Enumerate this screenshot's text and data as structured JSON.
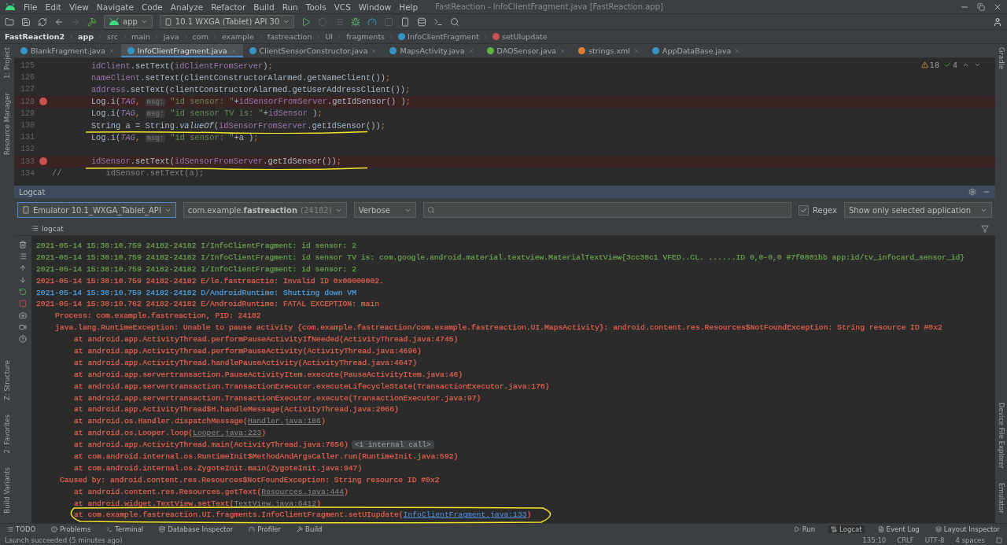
{
  "window": {
    "title": "FastReaction - InfoClientFragment.java [FastReaction.app]"
  },
  "menu": [
    "File",
    "Edit",
    "View",
    "Navigate",
    "Code",
    "Analyze",
    "Refactor",
    "Build",
    "Run",
    "Tools",
    "VCS",
    "Window",
    "Help"
  ],
  "toolbar": {
    "run_config": "app",
    "device": "10.1  WXGA (Tablet) API 30"
  },
  "breadcrumb": [
    {
      "label": "FastReaction2",
      "kind": "project"
    },
    {
      "label": "app",
      "kind": "module"
    },
    {
      "label": "src",
      "kind": "folder"
    },
    {
      "label": "main",
      "kind": "folder"
    },
    {
      "label": "java",
      "kind": "folder"
    },
    {
      "label": "com",
      "kind": "folder"
    },
    {
      "label": "example",
      "kind": "folder"
    },
    {
      "label": "fastreaction",
      "kind": "folder"
    },
    {
      "label": "UI",
      "kind": "folder"
    },
    {
      "label": "fragments",
      "kind": "folder"
    },
    {
      "label": "InfoClientFragment",
      "kind": "class"
    },
    {
      "label": "setUIupdate",
      "kind": "method"
    }
  ],
  "tabs": [
    {
      "label": "BlankFragment.java",
      "kind": "class",
      "selected": false
    },
    {
      "label": "InfoClientFragment.java",
      "kind": "class",
      "selected": true
    },
    {
      "label": "ClientSensorConstructor.java",
      "kind": "class",
      "selected": false
    },
    {
      "label": "MapsActivity.java",
      "kind": "class",
      "selected": false
    },
    {
      "label": "DAOSensor.java",
      "kind": "interface",
      "selected": false
    },
    {
      "label": "strings.xml",
      "kind": "xml",
      "selected": false
    },
    {
      "label": "AppDataBase.java",
      "kind": "class",
      "selected": false
    }
  ],
  "left_strip": {
    "top": [
      "1: Project",
      "Resource Manager"
    ],
    "bottom": [
      "Z: Structure",
      "2: Favorites",
      "Build Variants"
    ]
  },
  "right_strip": {
    "top": [
      "Gradle"
    ],
    "bottom": [
      "Device File Explorer",
      "Emulator"
    ]
  },
  "editor": {
    "warnings": "18",
    "checks": "4",
    "lines": [
      {
        "number": "125",
        "breakpoint": false,
        "underlined": false,
        "tokens": [
          {
            "kind": "field",
            "t": "        idClient"
          },
          {
            "kind": "plain",
            "t": ".setText("
          },
          {
            "kind": "field",
            "t": "idClientFromServer"
          },
          {
            "kind": "plain",
            "t": ")"
          },
          {
            "kind": "punct",
            "t": ";"
          }
        ]
      },
      {
        "number": "126",
        "breakpoint": false,
        "underlined": false,
        "tokens": [
          {
            "kind": "field",
            "t": "        nameClient"
          },
          {
            "kind": "plain",
            "t": ".setText(clientConstructorAlarmed.getNameClient())"
          },
          {
            "kind": "punct",
            "t": ";"
          }
        ]
      },
      {
        "number": "127",
        "breakpoint": false,
        "underlined": false,
        "tokens": [
          {
            "kind": "field",
            "t": "        address"
          },
          {
            "kind": "plain",
            "t": ".setText(clientConstructorAlarmed.getUserAddressClient())"
          },
          {
            "kind": "punct",
            "t": ";"
          }
        ]
      },
      {
        "number": "128",
        "breakpoint": true,
        "underlined": false,
        "tokens": [
          {
            "kind": "plain",
            "t": "        Log.i("
          },
          {
            "kind": "static",
            "t": "TAG"
          },
          {
            "kind": "punct",
            "t": ", "
          },
          {
            "kind": "hint",
            "t": "msg:"
          },
          {
            "kind": "string",
            "t": " \"id sensor: \""
          },
          {
            "kind": "plain",
            "t": "+"
          },
          {
            "kind": "field",
            "t": "idSensorFromServer"
          },
          {
            "kind": "plain",
            "t": ".getIdSensor() )"
          },
          {
            "kind": "punct",
            "t": ";"
          }
        ]
      },
      {
        "number": "129",
        "breakpoint": false,
        "underlined": false,
        "tokens": [
          {
            "kind": "plain",
            "t": "        Log.i("
          },
          {
            "kind": "static",
            "t": "TAG"
          },
          {
            "kind": "punct",
            "t": ", "
          },
          {
            "kind": "hint",
            "t": "msg:"
          },
          {
            "kind": "string",
            "t": " \"id sensor TV is: \""
          },
          {
            "kind": "plain",
            "t": "+"
          },
          {
            "kind": "field",
            "t": "idSensor"
          },
          {
            "kind": "plain",
            "t": " )"
          },
          {
            "kind": "punct",
            "t": ";"
          }
        ]
      },
      {
        "number": "130",
        "breakpoint": false,
        "underlined": true,
        "tokens": [
          {
            "kind": "plain",
            "t": "        String a = String."
          },
          {
            "kind": "italic",
            "t": "valueOf"
          },
          {
            "kind": "plain",
            "t": "("
          },
          {
            "kind": "field",
            "t": "idSensorFromServer"
          },
          {
            "kind": "plain",
            "t": ".getIdSensor())"
          },
          {
            "kind": "punct",
            "t": ";"
          }
        ]
      },
      {
        "number": "131",
        "breakpoint": false,
        "underlined": false,
        "tokens": [
          {
            "kind": "plain",
            "t": "        Log.i("
          },
          {
            "kind": "static",
            "t": "TAG"
          },
          {
            "kind": "punct",
            "t": ", "
          },
          {
            "kind": "hint",
            "t": "msg:"
          },
          {
            "kind": "string",
            "t": " \"id sensor: \""
          },
          {
            "kind": "plain",
            "t": "+a )"
          },
          {
            "kind": "punct",
            "t": ";"
          }
        ]
      },
      {
        "number": "132",
        "breakpoint": false,
        "underlined": false
      },
      {
        "number": "133",
        "breakpoint": true,
        "underlined": true,
        "tokens": [
          {
            "kind": "field",
            "t": "        idSensor"
          },
          {
            "kind": "plain",
            "t": ".setText("
          },
          {
            "kind": "field",
            "t": "idSensorFromServer"
          },
          {
            "kind": "plain",
            "t": ".getIdSensor())"
          },
          {
            "kind": "punct",
            "t": ";"
          }
        ]
      },
      {
        "number": "134",
        "breakpoint": false,
        "underlined": false,
        "tokens": [
          {
            "kind": "comment",
            "t": "//         idSensor.setText(a);"
          }
        ]
      }
    ]
  },
  "logcat": {
    "title": "Logcat",
    "device": "Emulator 10.1_WXGA_Tablet_API",
    "package": "com.example.**fastreaction**",
    "pid": "(24182)",
    "level": "Verbose",
    "regex": {
      "label": "Regex",
      "checked": true
    },
    "scope": "Show only selected application",
    "subtab": "logcat",
    "lines": [
      {
        "color": "#6a9f4f",
        "kind": "entry",
        "text": "2021-05-14 15:38:10.759 24182-24182 I/InfoClientFragment: id sensor: 2"
      },
      {
        "color": "#6a9f4f",
        "kind": "entry",
        "text": "2021-05-14 15:38:10.759 24182-24182 I/InfoClientFragment: id sensor TV is: com.google.android.material.textview.MaterialTextView{3cc38c1 VFED..CL. ......ID 0,0-0,0 #7f0801bb app:id/tv_infocard_sensor_id}"
      },
      {
        "color": "#6a9f4f",
        "kind": "entry",
        "text": "2021-05-14 15:38:10.759 24182-24182 I/InfoClientFragment: id sensor: 2"
      },
      {
        "color": "#e0604f",
        "kind": "entry",
        "text": "2021-05-14 15:38:10.759 24182-24182 E/le.fastreactio: Invalid ID 0x00000002."
      },
      {
        "color": "#4a9fe0",
        "kind": "entry",
        "text": "2021-05-14 15:38:10.759 24182-24182 D/AndroidRuntime: Shutting down VM"
      },
      {
        "color": "#e0604f",
        "kind": "entry",
        "text": "2021-05-14 15:38:10.762 24182-24182 E/AndroidRuntime: FATAL EXCEPTION: main"
      },
      {
        "color": "#e0604f",
        "kind": "detail",
        "text": "Process: com.example.fastreaction, PID: 24182"
      },
      {
        "color": "#e0604f",
        "kind": "detail",
        "text": "java.lang.RuntimeException: Unable to pause activity {com.example.fastreaction/com.example.fastreaction.UI.MapsActivity}: android.content.res.Resources$NotFoundException: String resource ID #0x2"
      },
      {
        "color": "#e0604f",
        "kind": "frame",
        "text": "at android.app.ActivityThread.performPauseActivityIfNeeded(ActivityThread.java:4745)"
      },
      {
        "color": "#e0604f",
        "kind": "frame",
        "text": "at android.app.ActivityThread.performPauseActivity(ActivityThread.java:4696)"
      },
      {
        "color": "#e0604f",
        "kind": "frame",
        "text": "at android.app.ActivityThread.handlePauseActivity(ActivityThread.java:4647)"
      },
      {
        "color": "#e0604f",
        "kind": "frame",
        "text": "at android.app.servertransaction.PauseActivityItem.execute(PauseActivityItem.java:46)"
      },
      {
        "color": "#e0604f",
        "kind": "frame",
        "text": "at android.app.servertransaction.TransactionExecutor.executeLifecycleState(TransactionExecutor.java:176)"
      },
      {
        "color": "#e0604f",
        "kind": "frame",
        "text": "at android.app.servertransaction.TransactionExecutor.execute(TransactionExecutor.java:97)"
      },
      {
        "color": "#e0604f",
        "kind": "frame",
        "text": "at android.app.ActivityThread$H.handleMessage(ActivityThread.java:2066)"
      },
      {
        "color": "#e0604f",
        "kind": "frame",
        "text": "at android.os.Handler.dispatchMessage(",
        "link": {
          "text": "Handler.java:186",
          "kind": "library"
        },
        "tail": ")"
      },
      {
        "color": "#e0604f",
        "kind": "frame",
        "text": "at android.os.Looper.loop(",
        "link": {
          "text": "Looper.java:223",
          "kind": "library"
        },
        "tail": ")"
      },
      {
        "color": "#e0604f",
        "kind": "frame",
        "text": "at android.app.ActivityThread.main(ActivityThread.java:7656)",
        "badge": "<1 internal call>"
      },
      {
        "color": "#e0604f",
        "kind": "frame",
        "text": "at com.android.internal.os.RuntimeInit$MethodAndArgsCaller.run(RuntimeInit.java:592)"
      },
      {
        "color": "#e0604f",
        "kind": "frame",
        "text": "at com.android.internal.os.ZygoteInit.main(ZygoteInit.java:947)"
      },
      {
        "color": "#e0604f",
        "kind": "cause",
        "text": "Caused by: android.content.res.Resources$NotFoundException: String resource ID #0x2"
      },
      {
        "color": "#e0604f",
        "kind": "frame",
        "text": "at android.content.res.Resources.getText(",
        "link": {
          "text": "Resources.java:444",
          "kind": "library"
        },
        "tail": ")"
      },
      {
        "color": "#e0604f",
        "kind": "frame",
        "text": "at android.widget.TextView.setText(",
        "link": {
          "text": "TextView.java:6412",
          "kind": "library"
        },
        "tail": ")"
      },
      {
        "color": "#e0604f",
        "kind": "frame",
        "text": "at com.example.fastreaction.UI.fragments.InfoClientFragment.setUIupdate(",
        "link": {
          "text": "InfoClientFragment.java:133",
          "kind": "project"
        },
        "tail": ")",
        "circled": true
      }
    ]
  },
  "tool_windows": {
    "left": [
      {
        "label": "TODO",
        "kind": "todo",
        "selected": false
      },
      {
        "label": "Problems",
        "kind": "problems",
        "selected": false
      },
      {
        "label": "Terminal",
        "kind": "terminal",
        "selected": false
      },
      {
        "label": "Database Inspector",
        "kind": "database",
        "selected": false
      },
      {
        "label": "Profiler",
        "kind": "profiler",
        "selected": false
      },
      {
        "label": "Build",
        "kind": "build",
        "selected": false
      }
    ],
    "right": [
      {
        "label": "Run",
        "kind": "run",
        "selected": false
      },
      {
        "label": "Logcat",
        "kind": "logcat",
        "selected": true
      },
      {
        "label": "Event Log",
        "kind": "log",
        "selected": false
      },
      {
        "label": "Layout Inspector",
        "kind": "layout",
        "selected": false
      }
    ]
  },
  "status_bar": {
    "message": "Launch succeeded (5 minutes ago)",
    "position": "135:10",
    "line_separator": "CRLF",
    "encoding": "UTF-8",
    "indent": "4 spaces"
  }
}
